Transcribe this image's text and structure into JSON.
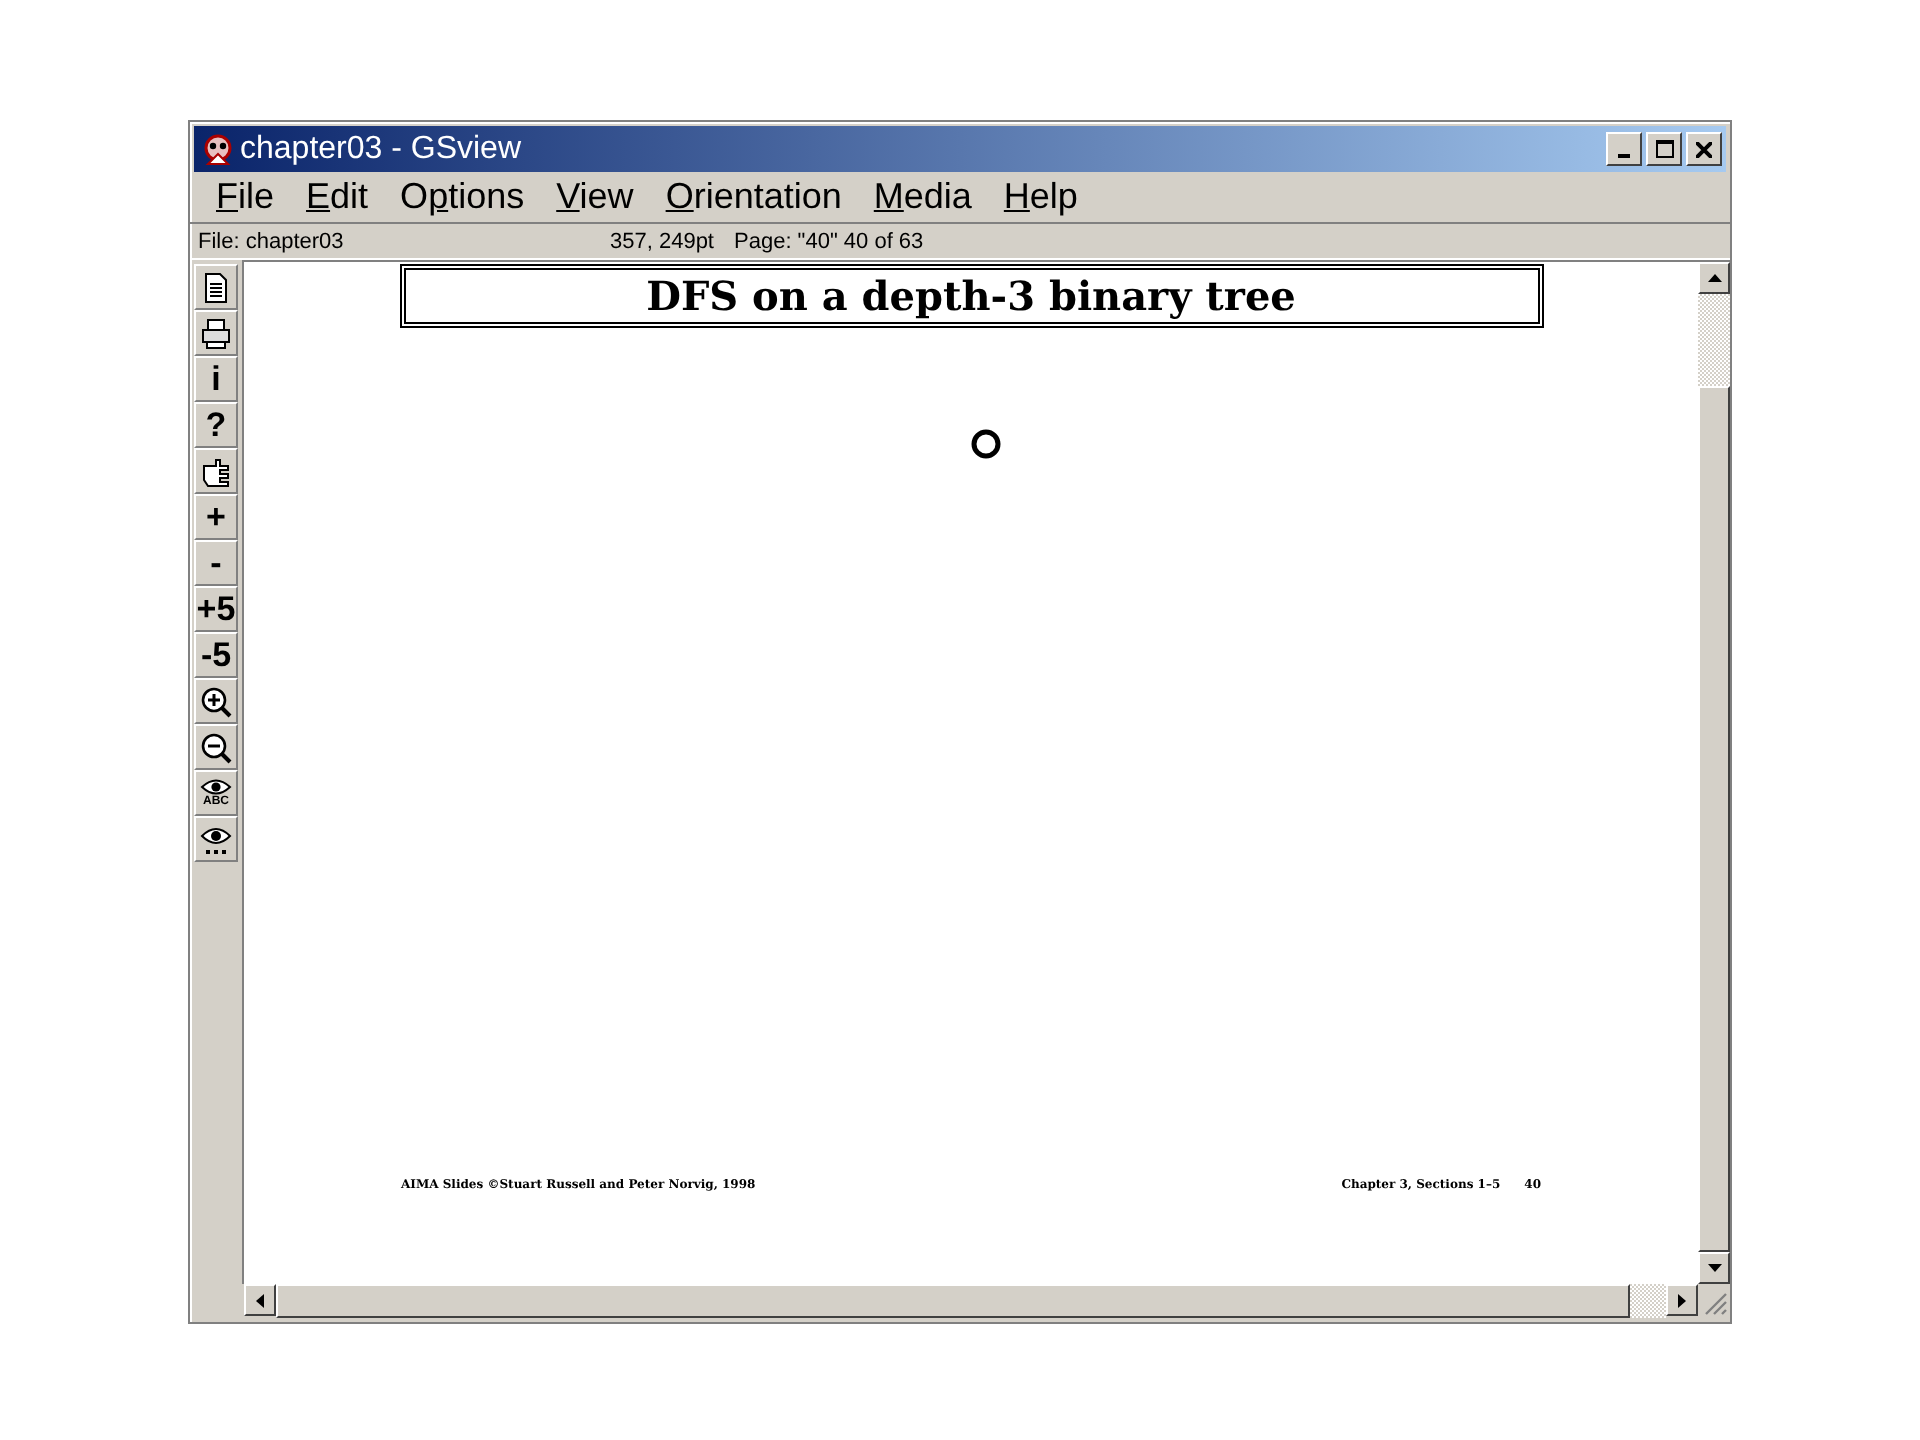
{
  "window": {
    "title": "chapter03 - GSview"
  },
  "menu": [
    {
      "label": "File"
    },
    {
      "label": "Edit"
    },
    {
      "label": "Options"
    },
    {
      "label": "View"
    },
    {
      "label": "Orientation"
    },
    {
      "label": "Media"
    },
    {
      "label": "Help"
    }
  ],
  "status_bar": {
    "file": "File: chapter03",
    "coords": "357, 249pt",
    "page": "Page: \"40\"  40 of 63"
  },
  "toolbar": [
    {
      "kind": "page"
    },
    {
      "kind": "printer"
    },
    {
      "kind": "glyph",
      "label": "i"
    },
    {
      "kind": "glyph",
      "label": "?"
    },
    {
      "kind": "hand"
    },
    {
      "kind": "glyph",
      "label": "+"
    },
    {
      "kind": "glyph",
      "label": "-"
    },
    {
      "kind": "glyph",
      "label": "+5"
    },
    {
      "kind": "glyph",
      "label": "-5"
    },
    {
      "kind": "zoom-in"
    },
    {
      "kind": "zoom-out"
    },
    {
      "kind": "eye-text",
      "label": "ABC"
    },
    {
      "kind": "eye-dots"
    }
  ],
  "document": {
    "title": "DFS on a depth-3 binary tree",
    "footer_left": "AIMA Slides ©Stuart Russell and Peter Norvig, 1998",
    "footer_right": "Chapter 3, Sections 1–5",
    "page_number": "40"
  }
}
